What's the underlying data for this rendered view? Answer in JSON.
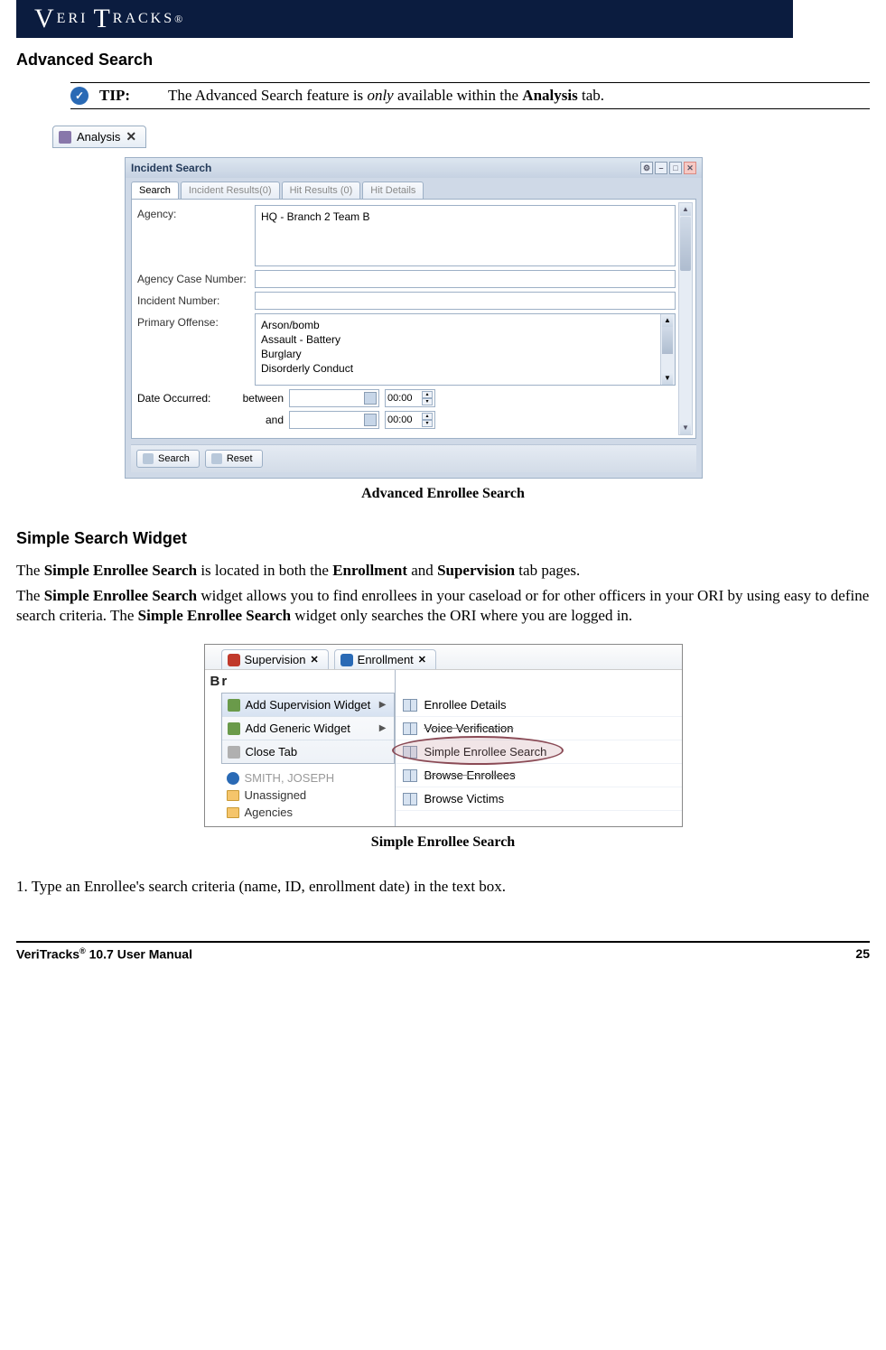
{
  "header": {
    "logo_text": "VERITRACKS",
    "reg": "®"
  },
  "section1": {
    "heading": "Advanced Search"
  },
  "tip": {
    "label": "TIP:",
    "text_pre": "The Advanced Search feature is ",
    "text_em": "only",
    "text_mid": " available within the ",
    "text_bold": "Analysis",
    "text_post": " tab."
  },
  "analysis_tab": {
    "label": "Analysis",
    "close": "✕"
  },
  "incident_window": {
    "title": "Incident Search",
    "tabs": [
      "Search",
      "Incident Results(0)",
      "Hit Results (0)",
      "Hit Details"
    ],
    "fields": {
      "agency_label": "Agency:",
      "agency_value": "HQ - Branch 2 Team B",
      "case_label": "Agency Case Number:",
      "incident_label": "Incident Number:",
      "offense_label": "Primary Offense:",
      "offenses": [
        "Arson/bomb",
        "Assault - Battery",
        "Burglary",
        "Disorderly Conduct"
      ],
      "date_label": "Date Occurred:",
      "between": "between",
      "and": "and",
      "time1": "00:00",
      "time2": "00:00"
    },
    "buttons": {
      "search": "Search",
      "reset": "Reset"
    }
  },
  "fig1_caption": "Advanced Enrollee Search",
  "section2": {
    "heading": "Simple Search Widget",
    "p1_pre": "The ",
    "p1_b1": "Simple Enrollee Search",
    "p1_mid1": " is located in both the ",
    "p1_b2": "Enrollment",
    "p1_mid2": " and ",
    "p1_b3": "Supervision",
    "p1_post": " tab pages.",
    "p2_pre": "The ",
    "p2_b1": "Simple Enrollee Search",
    "p2_mid1": " widget allows you to find enrollees in your caseload or for other officers in your ORI by using easy to define search criteria.  The ",
    "p2_b2": "Simple Enrollee Search",
    "p2_post": " widget only searches the ORI where you are logged in."
  },
  "menu_fig": {
    "tabs": {
      "supervision": "Supervision",
      "enrollment": "Enrollment",
      "close": "✕"
    },
    "br_label": "Br",
    "left_menu": [
      {
        "label": "Add Supervision Widget",
        "hl": true,
        "arrow": true
      },
      {
        "label": "Add Generic Widget",
        "hl": false,
        "arrow": true
      },
      {
        "label": "Close Tab",
        "hl": false,
        "arrow": false
      }
    ],
    "tree": [
      {
        "label": "SMITH, JOSEPH",
        "dim": true
      },
      {
        "label": "Unassigned",
        "dim": false
      },
      {
        "label": "Agencies",
        "dim": false
      }
    ],
    "submenu": [
      "Enrollee Details",
      "Voice Verification",
      "Simple Enrollee Search",
      "Browse Enrollees",
      "Browse Victims"
    ]
  },
  "fig2_caption": "Simple Enrollee Search",
  "step1": "1.  Type an Enrollee's search criteria (name, ID, enrollment date) in the text box.",
  "footer": {
    "left_pre": "VeriTracks",
    "left_sup": "®",
    "left_post": " 10.7 User Manual",
    "page": "25"
  }
}
